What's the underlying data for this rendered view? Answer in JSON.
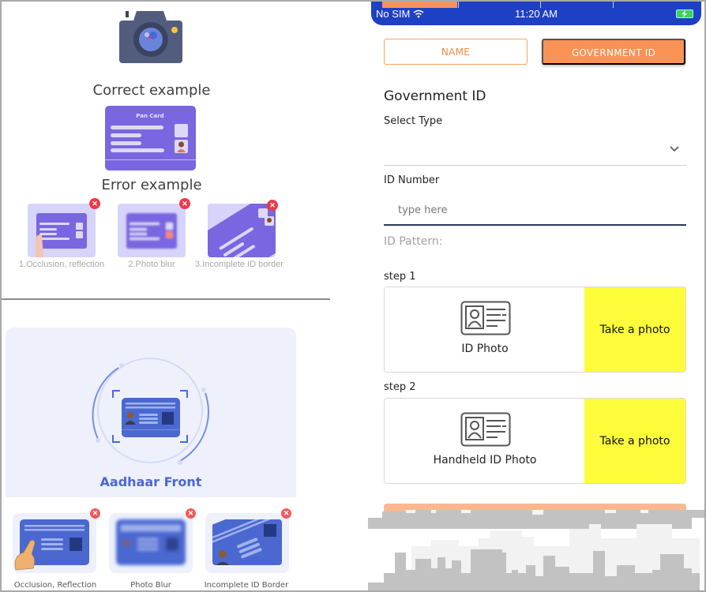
{
  "left_top": {
    "correct_title": "Correct example",
    "error_title": "Error example",
    "pan_card_label": "Pan Card",
    "error_examples": [
      {
        "label": "1.Occlusion, reflection"
      },
      {
        "label": "2.Photo blur"
      },
      {
        "label": "3.Incomplete ID border"
      }
    ],
    "error_badge": "✕"
  },
  "left_bottom": {
    "title": "Aadhaar Front",
    "error_examples": [
      {
        "label": "Occlusion, Reflection"
      },
      {
        "label": "Photo Blur"
      },
      {
        "label": "Incomplete ID Border"
      }
    ],
    "error_badge": "✕"
  },
  "phone": {
    "status_bar": {
      "carrier": "No SIM",
      "time": "11:20 AM"
    },
    "tabs": [
      {
        "label": "NAME",
        "active": false
      },
      {
        "label": "GOVERNMENT ID",
        "active": true
      }
    ],
    "section_title": "Government ID",
    "select_type": {
      "label": "Select Type",
      "value": ""
    },
    "id_number": {
      "label": "ID Number",
      "value": "",
      "placeholder": "type here"
    },
    "id_pattern_label": "ID Pattern:",
    "steps": [
      {
        "step_label": "step 1",
        "caption": "ID Photo",
        "button": "Take a photo"
      },
      {
        "step_label": "step 2",
        "caption": "Handheld ID Photo",
        "button": "Take a photo"
      }
    ]
  },
  "colors": {
    "accent_orange": "#f99254",
    "status_bar_blue": "#1e40c4",
    "photo_button_yellow": "#fcfc3a",
    "card_purple": "#7a66e0",
    "aadhaar_blue": "#4a68d0",
    "error_red": "#ea3a4a"
  }
}
